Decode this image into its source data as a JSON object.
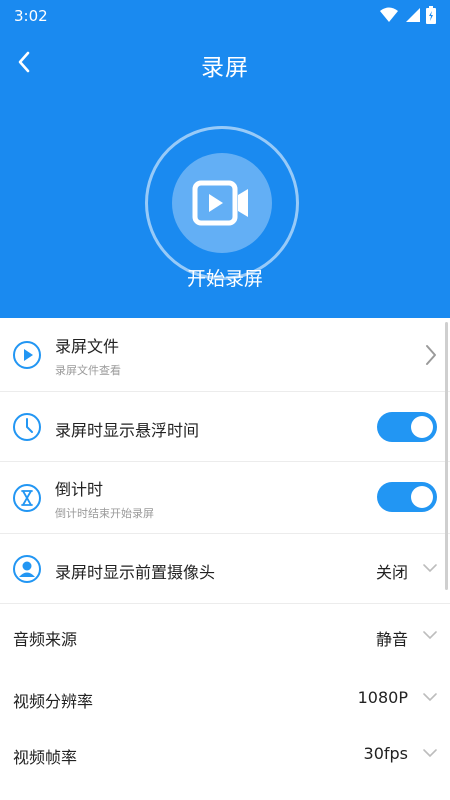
{
  "status_bar": {
    "time": "3:02",
    "icons": [
      "wifi-icon",
      "signal-icon",
      "battery-icon"
    ]
  },
  "header": {
    "title": "录屏",
    "start_label": "开始录屏",
    "background_color": "#1a8af0"
  },
  "rows": [
    {
      "title": "录屏文件",
      "subtitle": "录屏文件查看",
      "icon": "play-circle-icon",
      "control": "chevron-right"
    },
    {
      "title": "录屏时显示悬浮时间",
      "icon": "clock-icon",
      "control": "toggle",
      "toggle_on": true
    },
    {
      "title": "倒计时",
      "subtitle": "倒计时结束开始录屏",
      "icon": "hourglass-icon",
      "control": "toggle",
      "toggle_on": true
    },
    {
      "title": "录屏时显示前置摄像头",
      "icon": "user-icon",
      "control": "dropdown",
      "value": "关闭"
    },
    {
      "title": "音频来源",
      "control": "dropdown",
      "value": "静音"
    },
    {
      "title": "视频分辨率",
      "control": "dropdown",
      "value": "1080P"
    },
    {
      "title": "视频帧率",
      "control": "dropdown",
      "value": "30fps"
    }
  ],
  "accent_color": "#2296f3"
}
